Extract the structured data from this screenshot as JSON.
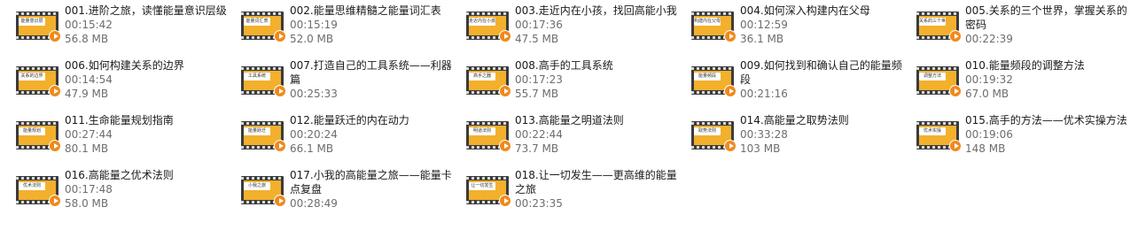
{
  "files": [
    {
      "name": "001.进阶之旅，读懂能量意识层级",
      "duration": "00:15:42",
      "size": "56.8 MB",
      "thumb_text": "能量意识层"
    },
    {
      "name": "002.能量思维精髓之能量词汇表",
      "duration": "00:15:19",
      "size": "52.0 MB",
      "thumb_text": "能量词汇表"
    },
    {
      "name": "003.走近内在小孩，找回高能小我",
      "duration": "00:17:36",
      "size": "47.5 MB",
      "thumb_text": "走近内在小孩"
    },
    {
      "name": "004.如何深入构建内在父母",
      "duration": "00:12:59",
      "size": "36.1 MB",
      "thumb_text": "构建内在父母"
    },
    {
      "name": "005.关系的三个世界，掌握关系的密码",
      "duration": "00:22:39",
      "size": "",
      "thumb_text": "关系的三个世界"
    },
    {
      "name": "006.如何构建关系的边界",
      "duration": "00:14:54",
      "size": "47.9 MB",
      "thumb_text": "关系的边界"
    },
    {
      "name": "007.打造自己的工具系统——利器篇",
      "duration": "00:25:33",
      "size": "",
      "thumb_text": "工具系统"
    },
    {
      "name": "008.高手的工具系统",
      "duration": "00:17:23",
      "size": "55.7 MB",
      "thumb_text": "高手之器"
    },
    {
      "name": "009.如何找到和确认自己的能量频段",
      "duration": "00:21:16",
      "size": "",
      "thumb_text": "能量频段"
    },
    {
      "name": "010.能量频段的调整方法",
      "duration": "00:19:32",
      "size": "67.0 MB",
      "thumb_text": "调整方法"
    },
    {
      "name": "011.生命能量规划指南",
      "duration": "00:27:44",
      "size": "80.1 MB",
      "thumb_text": "能量规划"
    },
    {
      "name": "012.能量跃迁的内在动力",
      "duration": "00:20:24",
      "size": "66.1 MB",
      "thumb_text": "能量跃迁"
    },
    {
      "name": "013.高能量之明道法则",
      "duration": "00:22:44",
      "size": "73.7 MB",
      "thumb_text": "明道法则"
    },
    {
      "name": "014.高能量之取势法则",
      "duration": "00:33:28",
      "size": "103 MB",
      "thumb_text": "取势法则"
    },
    {
      "name": "015.高手的方法——优术实操方法",
      "duration": "00:19:06",
      "size": "148 MB",
      "thumb_text": "优术实操"
    },
    {
      "name": "016.高能量之优术法则",
      "duration": "00:17:48",
      "size": "58.0 MB",
      "thumb_text": "优术法则"
    },
    {
      "name": "017.小我的高能量之旅——能量卡点复盘",
      "duration": "00:28:49",
      "size": "",
      "thumb_text": "小我之旅"
    },
    {
      "name": "018.让一切发生——更高维的能量之旅",
      "duration": "00:23:35",
      "size": "",
      "thumb_text": "让一切发生"
    }
  ]
}
